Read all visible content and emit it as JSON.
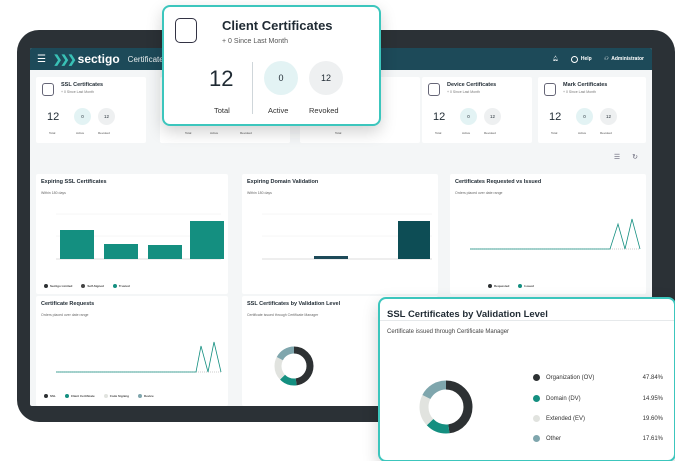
{
  "app": {
    "brand": "sectigo",
    "section": "Certificates",
    "help": "Help",
    "user": "Administrator"
  },
  "stat_cards": [
    {
      "title": "SSL Certificates",
      "since": "+ 0 Since Last Month",
      "total": "12",
      "active": "0",
      "revoked": "12"
    },
    {
      "title": "Device Certificates",
      "since": "+ 0 Since Last Month",
      "total": "12",
      "active": "0",
      "revoked": "12"
    },
    {
      "title": "Mark Certificates",
      "since": "+ 0 Since Last Month",
      "total": "12",
      "active": "0",
      "revoked": "12"
    }
  ],
  "stat_labels": {
    "total": "Total",
    "active": "Active",
    "revoked": "Revoked"
  },
  "client_card": {
    "title": "Client Certificates",
    "since": "+ 0 Since Last Month",
    "total": "12",
    "active": "0",
    "revoked": "12",
    "total_label": "Total",
    "active_label": "Active",
    "revoked_label": "Revoked"
  },
  "panels": {
    "expiring_ssl": {
      "title": "Expiring SSL Certificates",
      "subtitle": "Within 180 days"
    },
    "expiring_domain": {
      "title": "Expiring Domain Validation",
      "subtitle": "Within 180 days"
    },
    "requested_vs_issued": {
      "title": "Certificates Requested vs Issued",
      "subtitle": "Orders placed over date range"
    },
    "cert_requests": {
      "title": "Certificate Requests",
      "subtitle": "Orders placed over date range"
    },
    "ssl_by_validation": {
      "title": "SSL Certificates by Validation Level",
      "subtitle": "Certificate issued through Certificate Manager"
    }
  },
  "legends": {
    "expiring_ssl": [
      "Sectigo Limited",
      "Self-Signed",
      "Trusted"
    ],
    "requested_vs_issued": [
      "Requested",
      "Issued"
    ],
    "cert_requests": [
      "SSL",
      "Client Certificate",
      "Code Signing",
      "Device"
    ]
  },
  "colors": {
    "teal": "#148f80",
    "dark": "#2d3133",
    "accent": "#3cc6bd",
    "navy": "#1d4a59",
    "light": "#e1e3df",
    "slate": "#7fa6ad"
  },
  "validation_card": {
    "title": "SSL Certificates by Validation Level",
    "subtitle": "Certificate issued through Certificate Manager",
    "items": [
      {
        "label": "Organization (OV)",
        "value": "47.84%",
        "color": "#2d3133"
      },
      {
        "label": "Domain (DV)",
        "value": "14.95%",
        "color": "#148f80"
      },
      {
        "label": "Extended (EV)",
        "value": "19.60%",
        "color": "#e1e3df"
      },
      {
        "label": "Other",
        "value": "17.61%",
        "color": "#7fa6ad"
      }
    ]
  }
}
